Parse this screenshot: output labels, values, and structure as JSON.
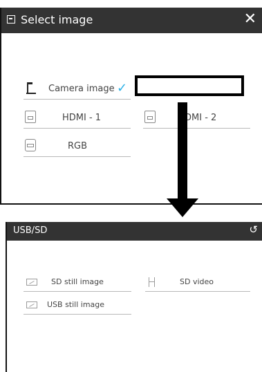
{
  "select_dialog": {
    "title": "Select image",
    "close_glyph": "✕",
    "sources": [
      {
        "label": "Camera image",
        "icon": "camera-stand-icon",
        "selected": true
      },
      {
        "label": "",
        "icon": "highlight-box",
        "selected": false
      },
      {
        "label": "HDMI - 1",
        "icon": "hdmi-icon",
        "selected": false
      },
      {
        "label": "DMI - 2",
        "icon": "hdmi-icon",
        "selected": false
      },
      {
        "label": "RGB",
        "icon": "rgb-icon",
        "selected": false
      }
    ],
    "check_glyph": "✓",
    "check_color": "#2ab0e6"
  },
  "usb_panel": {
    "title": "USB/SD",
    "refresh_glyph": "↺",
    "items": [
      {
        "label": "SD still image",
        "icon": "image-icon"
      },
      {
        "label": "SD video",
        "icon": "video-icon"
      },
      {
        "label": "USB still image",
        "icon": "image-icon"
      }
    ]
  },
  "colors": {
    "titlebar": "#333333",
    "accent": "#2ab0e6"
  }
}
